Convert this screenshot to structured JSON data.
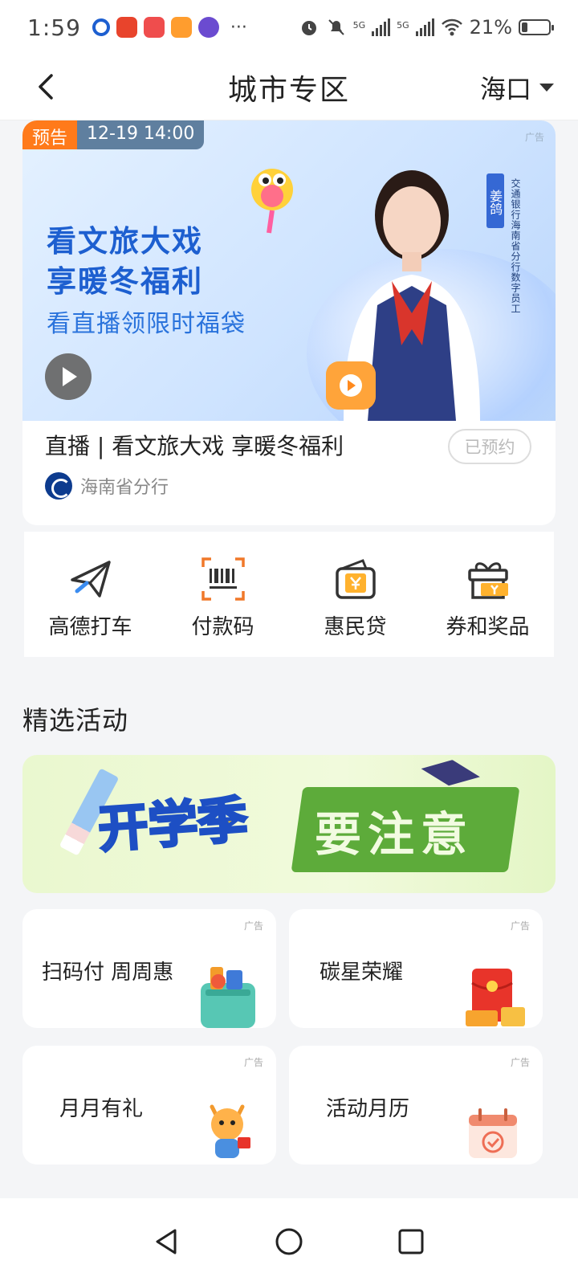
{
  "status_bar": {
    "time": "1:59",
    "more": "···",
    "net1": "5G",
    "net2": "5G",
    "battery": "21%"
  },
  "header": {
    "title": "城市专区",
    "city": "海口"
  },
  "live_card": {
    "tag": "预告",
    "datetime": "12-19 14:00",
    "ad": "广告",
    "headline_1": "看文旅大戏",
    "headline_2": "享暖冬福利",
    "subline": "看直播领限时福袋",
    "badge": "姜鸽",
    "badge_caption": "交通银行海南省分行数字员工",
    "title": "直播 | 看文旅大戏 享暖冬福利",
    "button": "已预约",
    "org": "海南省分行"
  },
  "quick": [
    {
      "label": "高德打车",
      "icon": "paper-plane-icon"
    },
    {
      "label": "付款码",
      "icon": "barcode-icon"
    },
    {
      "label": "惠民贷",
      "icon": "wallet-yen-icon"
    },
    {
      "label": "券和奖品",
      "icon": "gift-icon"
    }
  ],
  "section": {
    "title": "精选活动"
  },
  "promo": {
    "text_1": "开学季",
    "text_2": "要注意"
  },
  "cards": [
    {
      "label": "扫码付 周周惠",
      "ad": "广告"
    },
    {
      "label": "碳星荣耀",
      "ad": "广告"
    },
    {
      "label": "月月有礼",
      "ad": "广告"
    },
    {
      "label": "活动月历",
      "ad": "广告"
    }
  ],
  "colors": {
    "accent": "#1d5fd0",
    "tag_orange": "#ff7a1a",
    "icon_orange": "#f0782a"
  }
}
